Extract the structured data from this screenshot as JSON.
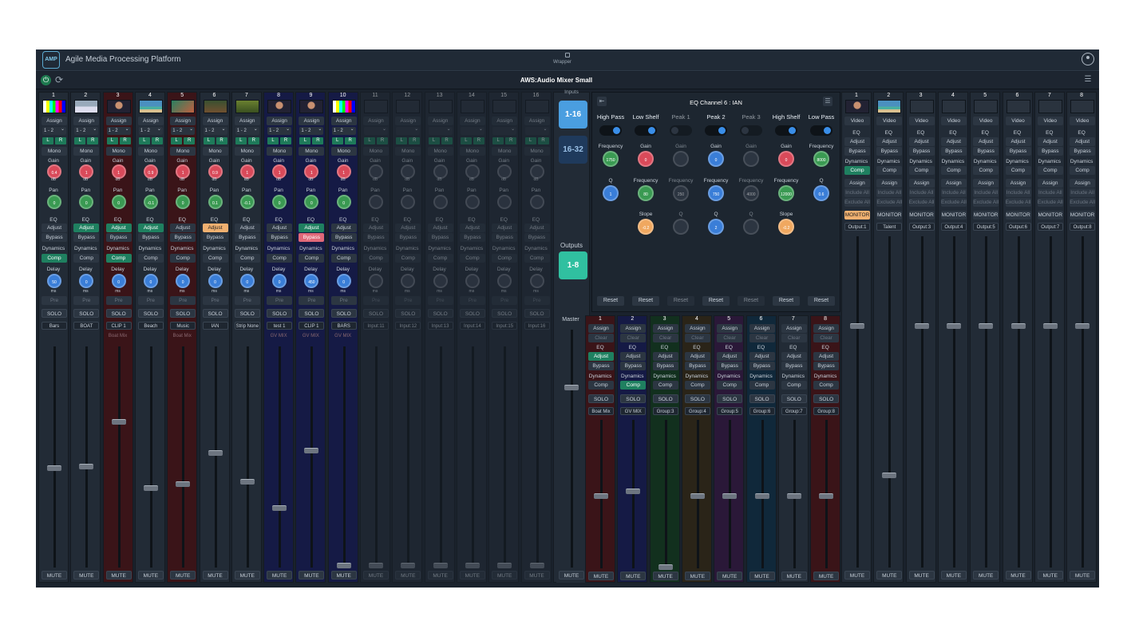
{
  "header": {
    "app_title": "Agile Media Processing Platform",
    "logo_text": "AMP",
    "wrapper_label": "Wrapper",
    "mixer_title": "AWS:Audio Mixer Small"
  },
  "colors": {
    "accent": "#1f8060",
    "adjust_active": "#f0b070",
    "bypass_active": "#e06878",
    "inputs_tab_active": "#4a9ee0",
    "outputs_tab": "#30c0a0"
  },
  "inputs": [
    {
      "num": "1",
      "color": "normal",
      "thumb": "bars",
      "route": "1 - 2",
      "gain": "0.4",
      "pan": "0",
      "eq_adjust": "off",
      "eq_bypass": "off",
      "comp": "on",
      "delay": "50",
      "name": "Bars",
      "group": "",
      "fader": 0.45
    },
    {
      "num": "2",
      "color": "normal",
      "thumb": "boat",
      "route": "1 - 2",
      "gain": "1",
      "pan": "0",
      "eq_adjust": "on",
      "eq_bypass": "off",
      "comp": "off",
      "delay": "0",
      "name": "BOAT",
      "group": "",
      "fader": 0.46
    },
    {
      "num": "3",
      "color": "red",
      "thumb": "person",
      "route": "1 - 2",
      "gain": "1",
      "pan": "0",
      "eq_adjust": "on",
      "eq_bypass": "off",
      "comp": "on",
      "delay": "0",
      "name": "CLIP 1",
      "group": "Boat Mix",
      "fader": 0.66
    },
    {
      "num": "4",
      "color": "normal",
      "thumb": "beach",
      "route": "1 - 2",
      "gain": "0.9",
      "pan": "-0.1",
      "eq_adjust": "on",
      "eq_bypass": "off",
      "comp": "off",
      "delay": "0",
      "name": "Beach",
      "group": "",
      "fader": 0.36
    },
    {
      "num": "5",
      "color": "red",
      "thumb": "music",
      "route": "1 - 2",
      "gain": "1",
      "pan": "0",
      "eq_adjust": "off",
      "eq_bypass": "off",
      "comp": "off",
      "delay": "0",
      "name": "Music",
      "group": "Boat Mix",
      "fader": 0.38
    },
    {
      "num": "6",
      "color": "normal",
      "thumb": "ian",
      "route": "1 - 2",
      "gain": "0.9",
      "pan": "0.1",
      "eq_adjust": "orange",
      "eq_bypass": "off",
      "comp": "off",
      "delay": "0",
      "name": "IAN",
      "group": "",
      "fader": 0.52
    },
    {
      "num": "7",
      "color": "normal",
      "thumb": "strip",
      "route": "1 - 2",
      "gain": "1",
      "pan": "-0.1",
      "eq_adjust": "off",
      "eq_bypass": "off",
      "comp": "off",
      "delay": "0",
      "name": "Strip None",
      "group": "",
      "fader": 0.39
    },
    {
      "num": "8",
      "color": "blue",
      "thumb": "person",
      "route": "1 - 2",
      "gain": "1",
      "pan": "0",
      "eq_adjust": "off",
      "eq_bypass": "off",
      "comp": "off",
      "delay": "0",
      "name": "test 1",
      "group": "GV MIX",
      "fader": 0.27
    },
    {
      "num": "9",
      "color": "blue",
      "thumb": "person",
      "route": "1 - 2",
      "gain": "1",
      "pan": "0",
      "eq_adjust": "on",
      "eq_bypass": "pink",
      "comp": "off",
      "delay": "450",
      "name": "CLIP 1",
      "group": "GV MIX",
      "fader": 0.53
    },
    {
      "num": "10",
      "color": "blue",
      "thumb": "bars",
      "route": "1 - 2",
      "gain": "1",
      "pan": "0",
      "eq_adjust": "off",
      "eq_bypass": "off",
      "comp": "off",
      "delay": "0",
      "name": "BARS",
      "group": "GV MIX",
      "fader": 0.01
    },
    {
      "num": "11",
      "color": "dim",
      "thumb": "",
      "route": "",
      "gain": "",
      "pan": "",
      "eq_adjust": "off",
      "eq_bypass": "off",
      "comp": "off",
      "delay": "",
      "name": "Input:11",
      "group": "",
      "fader": 0.01
    },
    {
      "num": "12",
      "color": "dim",
      "thumb": "",
      "route": "",
      "gain": "",
      "pan": "",
      "eq_adjust": "off",
      "eq_bypass": "off",
      "comp": "off",
      "delay": "",
      "name": "Input:12",
      "group": "",
      "fader": 0.01
    },
    {
      "num": "13",
      "color": "dim",
      "thumb": "",
      "route": "",
      "gain": "",
      "pan": "",
      "eq_adjust": "off",
      "eq_bypass": "off",
      "comp": "off",
      "delay": "",
      "name": "Input:13",
      "group": "",
      "fader": 0.01
    },
    {
      "num": "14",
      "color": "dim",
      "thumb": "",
      "route": "",
      "gain": "",
      "pan": "",
      "eq_adjust": "off",
      "eq_bypass": "off",
      "comp": "off",
      "delay": "",
      "name": "Input:14",
      "group": "",
      "fader": 0.01
    },
    {
      "num": "15",
      "color": "dim",
      "thumb": "",
      "route": "",
      "gain": "",
      "pan": "",
      "eq_adjust": "off",
      "eq_bypass": "off",
      "comp": "off",
      "delay": "",
      "name": "Input:15",
      "group": "",
      "fader": 0.01
    },
    {
      "num": "16",
      "color": "dim",
      "thumb": "",
      "route": "",
      "gain": "",
      "pan": "",
      "eq_adjust": "off",
      "eq_bypass": "off",
      "comp": "off",
      "delay": "",
      "name": "Input:16",
      "group": "",
      "fader": 0.01
    }
  ],
  "labels": {
    "assign": "Assign",
    "mono": "Mono",
    "gain": "Gain",
    "db": "dB",
    "pan": "Pan",
    "eq": "EQ",
    "adjust": "Adjust",
    "bypass": "Bypass",
    "dynamics": "Dynamics",
    "comp": "Comp",
    "delay": "Delay",
    "ms": "ms",
    "pre": "Pre",
    "solo": "SOLO",
    "mute": "MUTE",
    "clear": "Clear",
    "l": "L",
    "r": "R",
    "video": "Video",
    "include_all": "Include All",
    "exclude_all": "Exclude All",
    "monitor": "MONITOR"
  },
  "tabs": {
    "inputs_label": "Inputs",
    "inputs_1_16": "1-16",
    "inputs_16_32": "16-32",
    "outputs_label": "Outputs",
    "outputs_1_8": "1-8"
  },
  "eq": {
    "title": "EQ Channel 6 : IAN",
    "bands": [
      {
        "name": "High Pass",
        "enabled": true,
        "k1_label": "Frequency",
        "k1": "1750",
        "k1_color": "green",
        "k2_label": "Q",
        "k2": "1",
        "k2_color": "blue",
        "k3_label": "",
        "k3": "",
        "k3_color": ""
      },
      {
        "name": "Low Shelf",
        "enabled": true,
        "k1_label": "Gain",
        "k1": "0",
        "k1_color": "red",
        "k2_label": "Frequency",
        "k2": "80",
        "k2_color": "green",
        "k3_label": "Slope",
        "k3": "-0.2",
        "k3_color": "orange"
      },
      {
        "name": "Peak 1",
        "enabled": false,
        "k1_label": "Gain",
        "k1": "",
        "k1_color": "dim",
        "k2_label": "Frequency",
        "k2": "250",
        "k2_color": "dim",
        "k3_label": "Q",
        "k3": "",
        "k3_color": "dim"
      },
      {
        "name": "Peak 2",
        "enabled": true,
        "k1_label": "Gain",
        "k1": "0",
        "k1_color": "blue",
        "k2_label": "Frequency",
        "k2": "750",
        "k2_color": "blue",
        "k3_label": "Q",
        "k3": "2",
        "k3_color": "blue"
      },
      {
        "name": "Peak 3",
        "enabled": false,
        "k1_label": "Gain",
        "k1": "",
        "k1_color": "dim",
        "k2_label": "Frequency",
        "k2": "4000",
        "k2_color": "dim",
        "k3_label": "Q",
        "k3": "",
        "k3_color": "dim"
      },
      {
        "name": "High Shelf",
        "enabled": true,
        "k1_label": "Gain",
        "k1": "0",
        "k1_color": "red",
        "k2_label": "Frequency",
        "k2": "12000",
        "k2_color": "green",
        "k3_label": "Slope",
        "k3": "-0.2",
        "k3_color": "orange"
      },
      {
        "name": "Low Pass",
        "enabled": true,
        "k1_label": "Frequency",
        "k1": "8000",
        "k1_color": "green",
        "k2_label": "Q",
        "k2": "0.6",
        "k2_color": "blue",
        "k3_label": "",
        "k3": "",
        "k3_color": ""
      }
    ],
    "reset_label": "Reset"
  },
  "master": {
    "label": "Master",
    "fader": 0.76
  },
  "groups": [
    {
      "num": "1",
      "color": "#3a1418",
      "adjust": "on",
      "comp": "off",
      "name": "Boat Mix",
      "fader": 0.49
    },
    {
      "num": "2",
      "color": "#151a45",
      "adjust": "off",
      "comp": "on",
      "name": "GV MIX",
      "fader": 0.52
    },
    {
      "num": "3",
      "color": "#12301e",
      "adjust": "off",
      "comp": "off",
      "name": "Group:3",
      "fader": 0.01
    },
    {
      "num": "4",
      "color": "#2a2418",
      "adjust": "off",
      "comp": "off",
      "name": "Group:4",
      "fader": 0.49
    },
    {
      "num": "5",
      "color": "#2a1838",
      "adjust": "off",
      "comp": "off",
      "name": "Group:5",
      "fader": 0.49
    },
    {
      "num": "6",
      "color": "#10283a",
      "adjust": "off",
      "comp": "off",
      "name": "Group:6",
      "fader": 0.49
    },
    {
      "num": "7",
      "color": "#222b36",
      "adjust": "off",
      "comp": "off",
      "name": "Group:7",
      "fader": 0.49
    },
    {
      "num": "8",
      "color": "#3a1418",
      "adjust": "off",
      "comp": "off",
      "name": "Group:8",
      "fader": 0.49
    }
  ],
  "outputs": [
    {
      "num": "1",
      "thumb": "person",
      "comp": "on",
      "monitor": "orange",
      "name": "Output:1",
      "fader": 0.73
    },
    {
      "num": "2",
      "thumb": "beach",
      "comp": "off",
      "monitor": "off",
      "name": "Talent",
      "fader": 0.28
    },
    {
      "num": "3",
      "thumb": "",
      "comp": "off",
      "monitor": "off",
      "name": "Output:3",
      "fader": 0.73
    },
    {
      "num": "4",
      "thumb": "",
      "comp": "off",
      "monitor": "off",
      "name": "Output:4",
      "fader": 0.73
    },
    {
      "num": "5",
      "thumb": "",
      "comp": "off",
      "monitor": "off",
      "name": "Output:5",
      "fader": 0.73
    },
    {
      "num": "6",
      "thumb": "",
      "comp": "off",
      "monitor": "off",
      "name": "Output:6",
      "fader": 0.73
    },
    {
      "num": "7",
      "thumb": "",
      "comp": "off",
      "monitor": "off",
      "name": "Output:7",
      "fader": 0.73
    },
    {
      "num": "8",
      "thumb": "",
      "comp": "off",
      "monitor": "off",
      "name": "Output:8",
      "fader": 0.73
    }
  ]
}
